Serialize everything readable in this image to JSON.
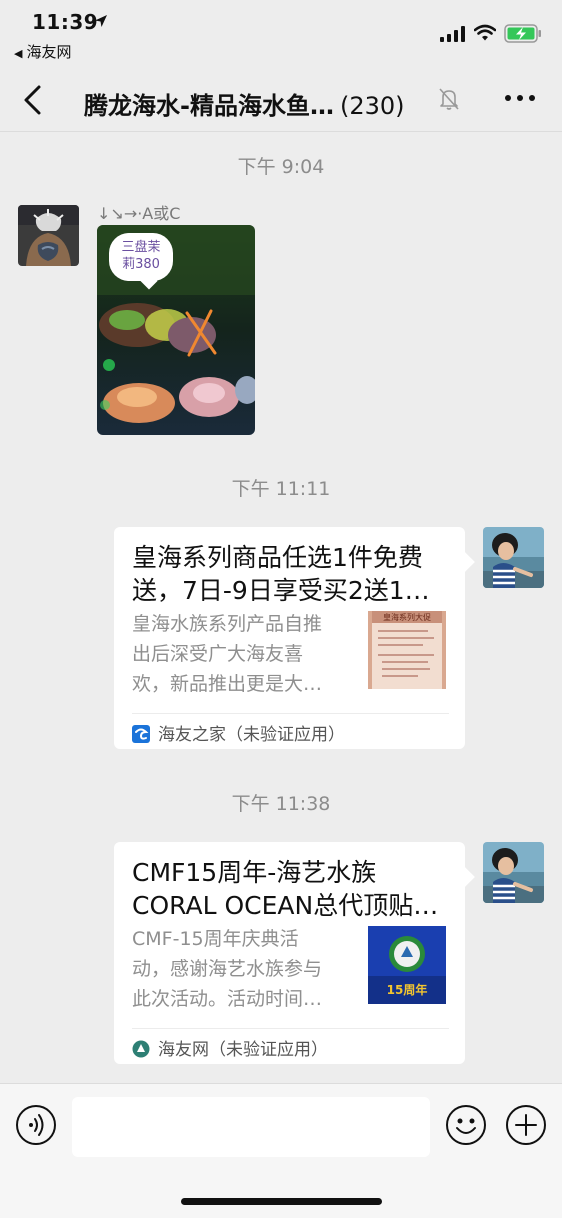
{
  "status_bar": {
    "time": "11:39",
    "back_app": "海友网"
  },
  "nav": {
    "title": "腾龙海水-精品海水鱼…",
    "count": "(230)"
  },
  "messages": [
    {
      "timestamp": "下午 9:04",
      "sender": "↓↘→·A或C",
      "photo_label_line1": "三盘茉",
      "photo_label_line2": "莉380"
    },
    {
      "timestamp": "下午 11:11",
      "card_title_line1": "皇海系列商品任选1件免费",
      "card_title_line2": "送，7日-9日享受买2送1…",
      "card_desc_line1": "皇海水族系列产品自推",
      "card_desc_line2": "出后深受广大海友喜",
      "card_desc_line3": "欢，新品推出更是大…",
      "thumb_text": "皇海系列大促",
      "source": "海友之家（未验证应用）"
    },
    {
      "timestamp": "下午 11:38",
      "card_title_line1": "CMF15周年-海艺水族",
      "card_title_line2": "CORAL OCEAN总代顶贴…",
      "card_desc_line1": "CMF-15周年庆典活",
      "card_desc_line2": "动，感谢海艺水族参与",
      "card_desc_line3": "此次活动。活动时间…",
      "thumb_text": "15周年",
      "source": "海友网（未验证应用）"
    }
  ],
  "input": {
    "value": ""
  },
  "colors": {
    "background": "#ededed",
    "card_bg": "#ffffff",
    "timestamp_text": "#8c8c8c",
    "desc_text": "#8f8f8f",
    "battery_green": "#34c759",
    "source_icon_blue": "#1a73d9",
    "source_icon_teal": "#2d7f74"
  },
  "icons": {
    "location": "location-arrow-icon",
    "signal": "cellular-signal-icon",
    "wifi": "wifi-icon",
    "battery": "battery-charging-icon",
    "back": "chevron-left-icon",
    "mute": "bell-off-icon",
    "more": "more-dots-icon",
    "voice": "voice-input-icon",
    "emoji": "emoji-smile-icon",
    "plus": "plus-circle-icon"
  }
}
